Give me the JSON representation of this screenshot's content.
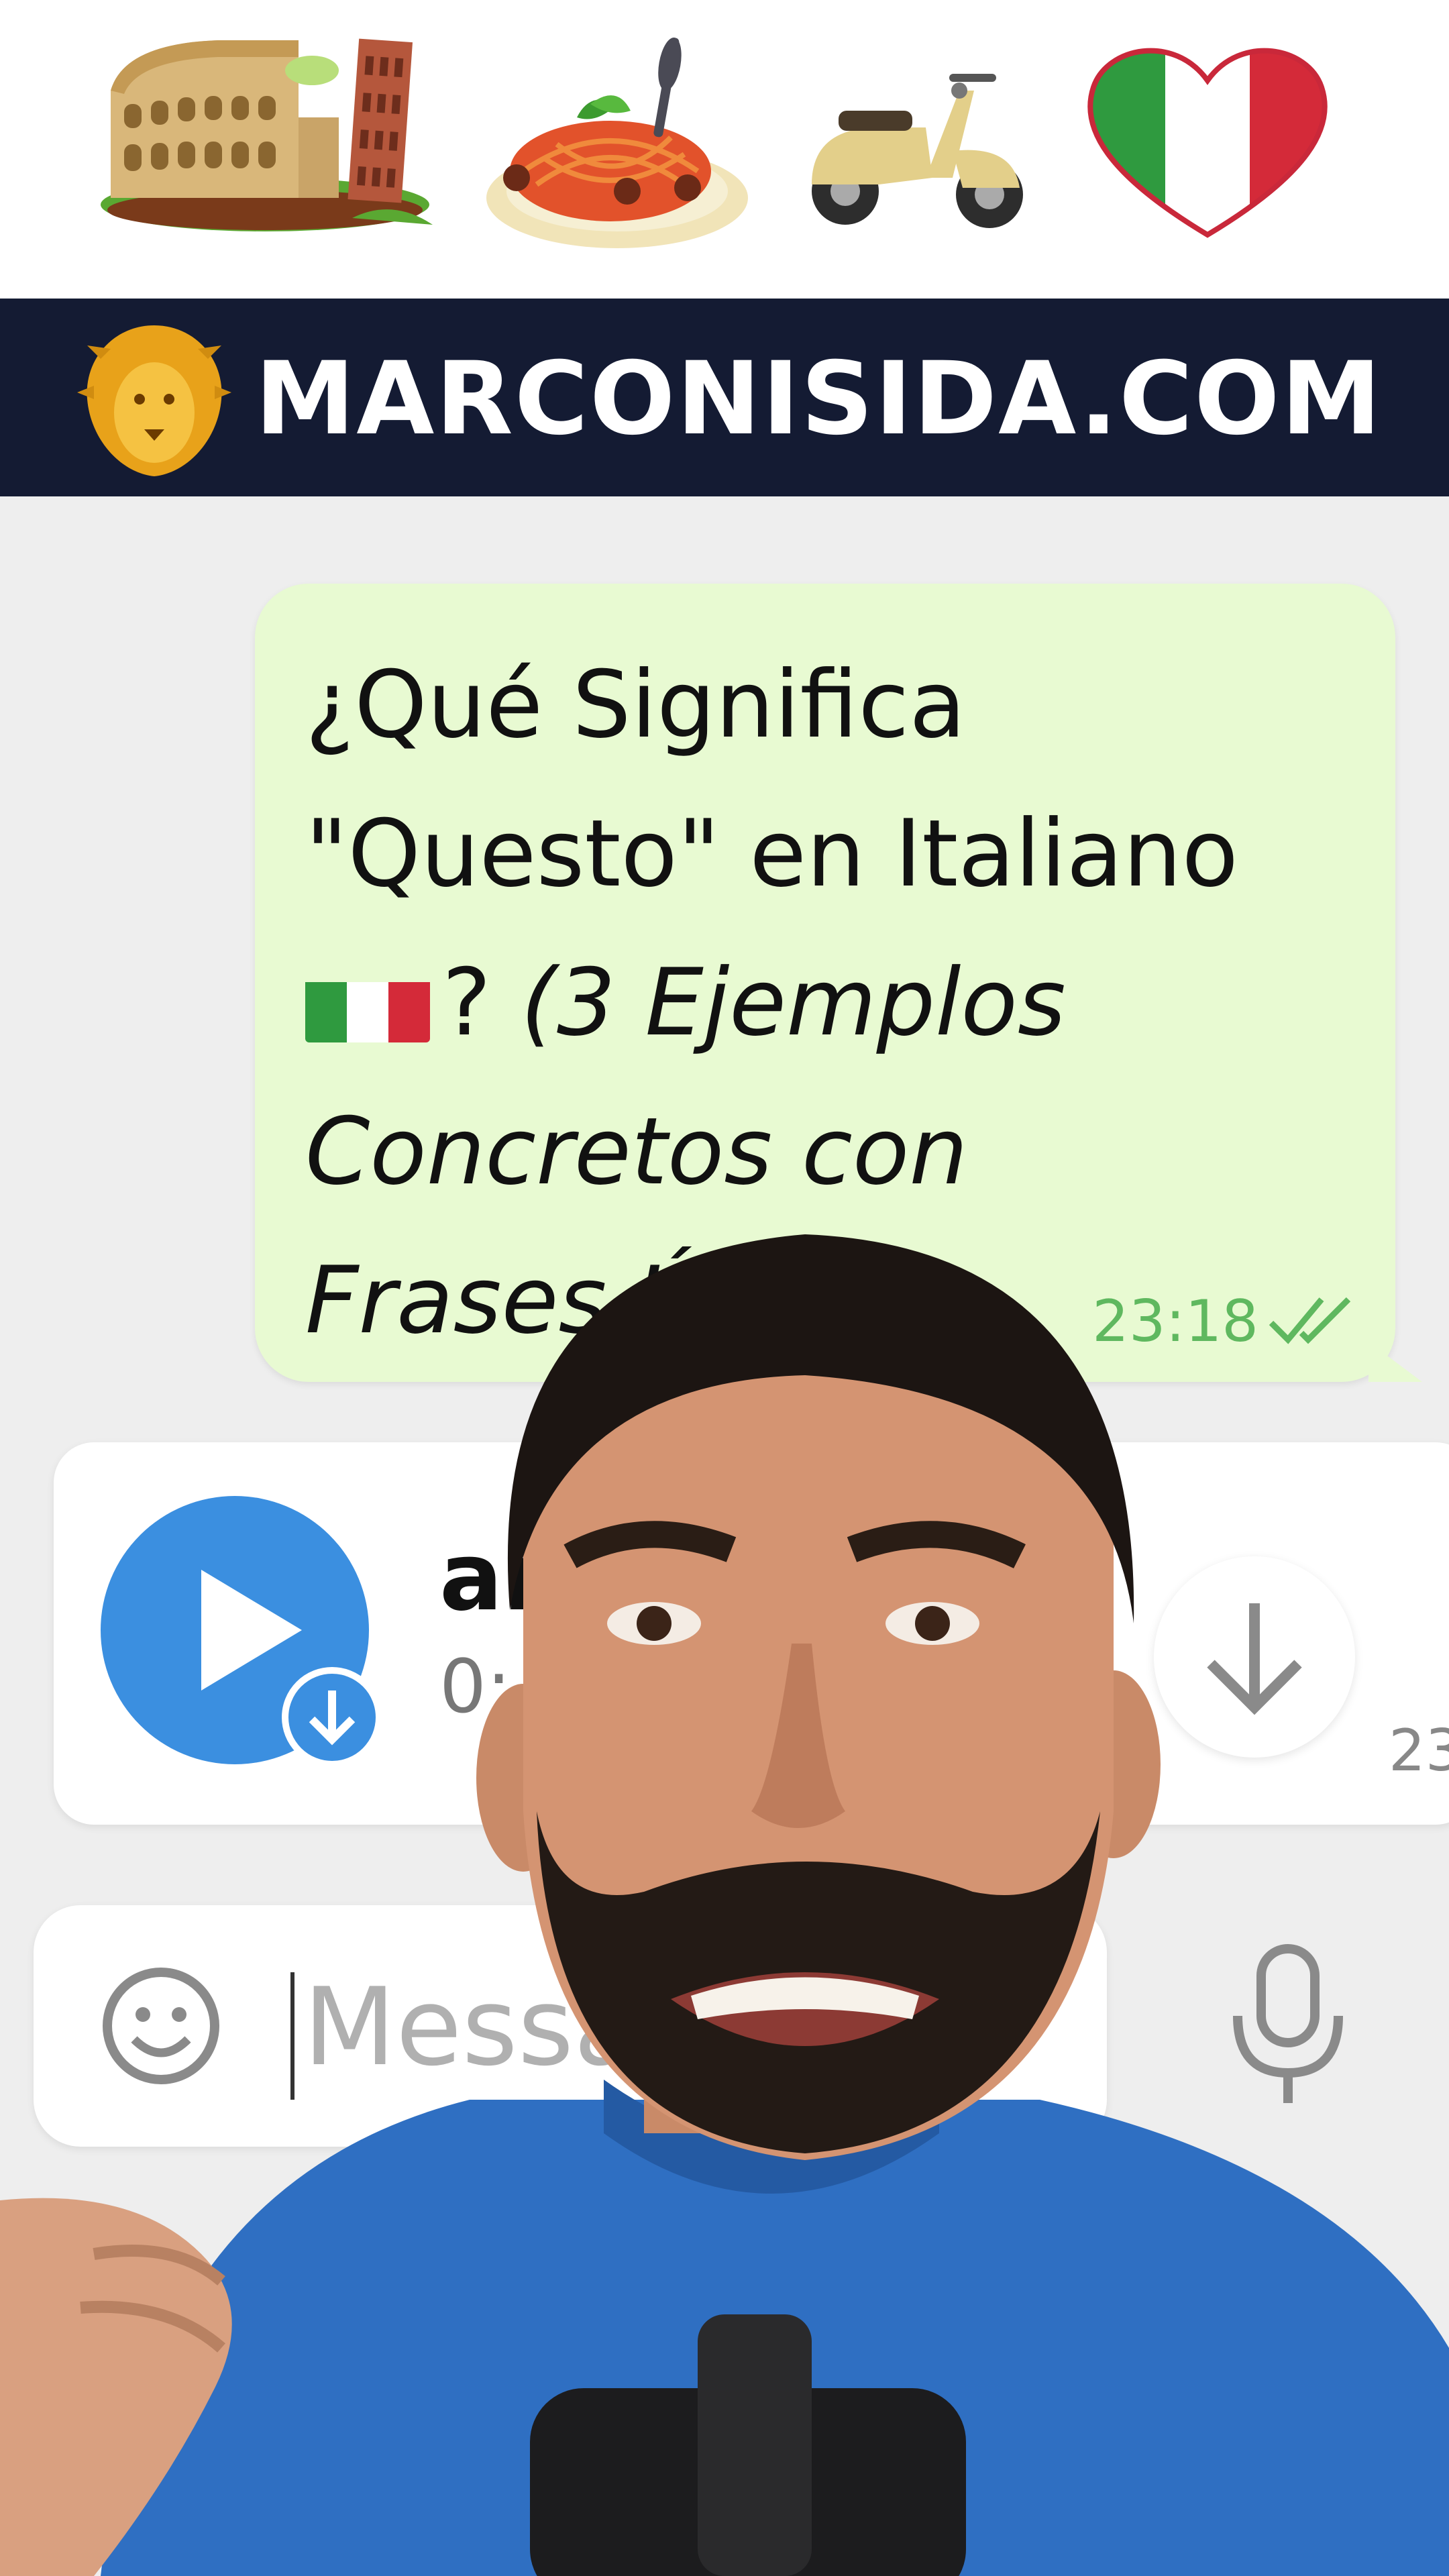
{
  "brand": {
    "site": "MARCONISIDA.COM",
    "background": "#141b33",
    "logo_icon": "lion-head-icon"
  },
  "icon_strip": [
    "colosseum-icon",
    "spaghetti-icon",
    "vespa-scooter-icon",
    "italy-heart-flag-icon"
  ],
  "message": {
    "line_1": "¿Qué Significa",
    "line_2": "\"Questo\" en Italiano",
    "flag_icon": "italy-flag-icon",
    "line_3_suffix": "?",
    "line_3_italic": "(3 Ejemplos",
    "line_4": "Concretos con",
    "line_5": "Frases Útiles)",
    "time": "23:18",
    "status_icon": "double-check-icon",
    "bubble_color": "#e8fad2"
  },
  "audio": {
    "name": "ar",
    "duration": "0:",
    "time": "23",
    "play_icon": "play-icon",
    "badge_icon": "download-arrow-icon",
    "download_icon": "arrow-down-icon",
    "accent": "#3b8fe0"
  },
  "composer": {
    "placeholder": "Message",
    "emoji_icon": "smiley-icon",
    "mic_icon": "microphone-icon"
  }
}
